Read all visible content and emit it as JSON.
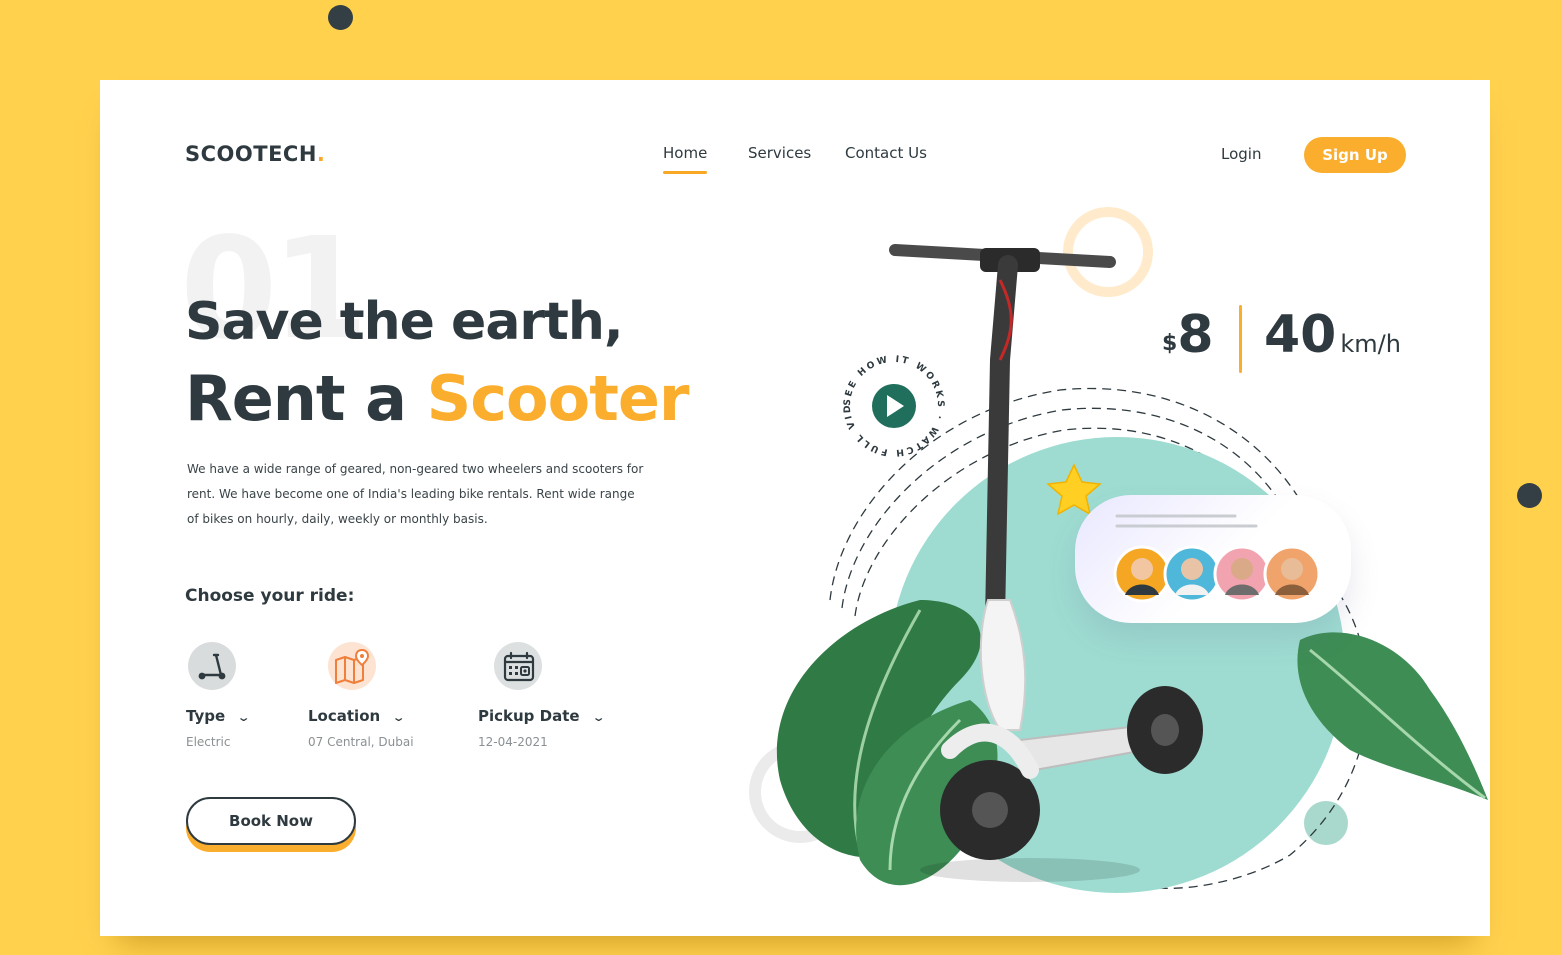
{
  "brand": {
    "name": "SCOOTECH",
    "dot": ".",
    "accent": "#F9A825",
    "background": "#FFD14D",
    "dark": "#2E3A3F"
  },
  "nav": {
    "items": [
      "Home",
      "Services",
      "Contact Us"
    ],
    "active": "Home"
  },
  "auth": {
    "login": "Login",
    "signup": "Sign Up"
  },
  "hero": {
    "number": "01",
    "line1": "Save the earth,",
    "line2_prefix": "Rent a",
    "line2_accent": "Scooter",
    "description": "We have a wide range of geared, non-geared two wheelers and scooters for rent. We have become one of India's leading bike rentals. Rent wide range of bikes on hourly, daily, weekly or monthly basis."
  },
  "booking": {
    "heading": "Choose your ride:",
    "options": [
      {
        "label": "Type",
        "value": "Electric",
        "icon": "scooter-icon"
      },
      {
        "label": "Location",
        "value": "07 Central, Dubai",
        "icon": "map-pin-icon"
      },
      {
        "label": "Pickup Date",
        "value": "12-04-2021",
        "icon": "calendar-icon"
      }
    ],
    "cta": "Book Now"
  },
  "stats": {
    "currency": "$",
    "price": "8",
    "speed": "40",
    "speed_unit": "km/h"
  },
  "video_badge": {
    "text": "SEE HOW IT WORKS · WATCH FULL VIDEO ·",
    "icon": "play-icon"
  },
  "review": {
    "rating_icon": "star-icon",
    "avatar_count": 4
  }
}
